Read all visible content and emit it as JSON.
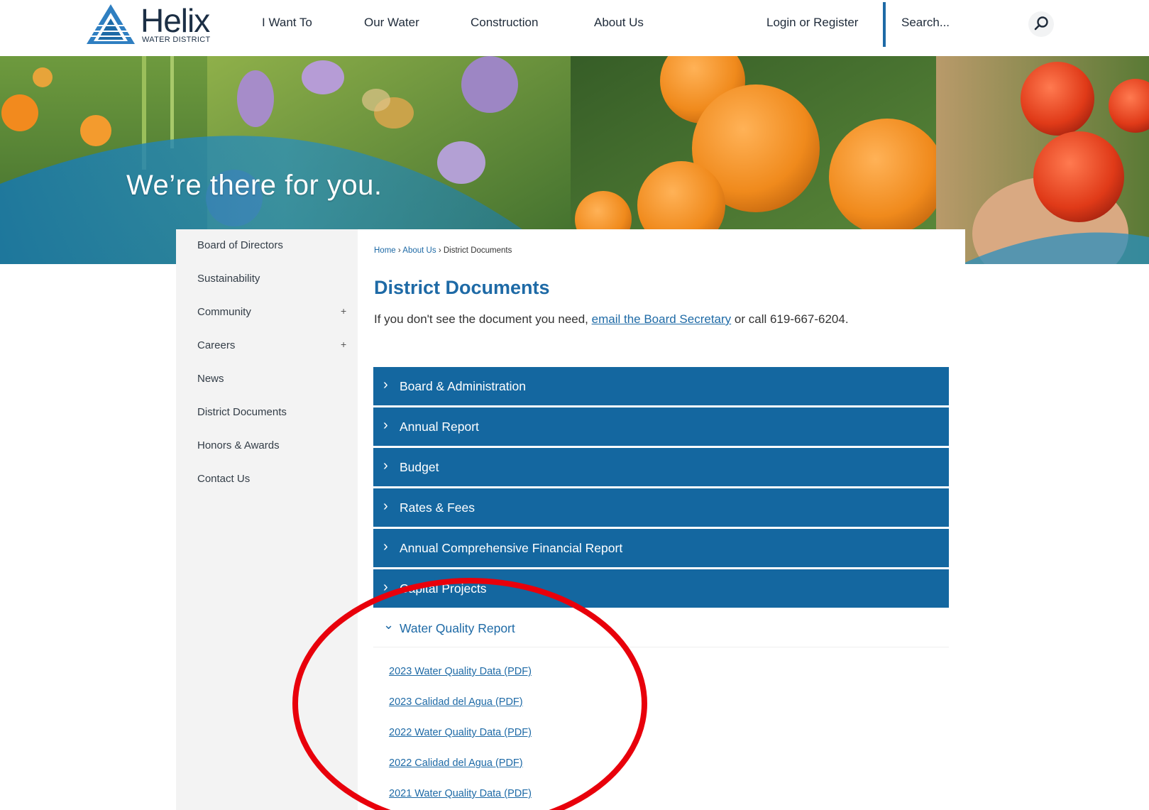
{
  "header": {
    "logo_word": "Helix",
    "logo_sub": "WATER DISTRICT",
    "nav": [
      "I Want To",
      "Our Water",
      "Construction",
      "About Us"
    ],
    "login": "Login or Register",
    "search_placeholder": "Search...",
    "search_icon": "search-icon"
  },
  "hero": {
    "tagline": "We’re there for you."
  },
  "sidebar": {
    "items": [
      {
        "label": "Board of Directors",
        "expandable": false
      },
      {
        "label": "Sustainability",
        "expandable": false
      },
      {
        "label": "Community",
        "expandable": true
      },
      {
        "label": "Careers",
        "expandable": true
      },
      {
        "label": "News",
        "expandable": false
      },
      {
        "label": "District Documents",
        "expandable": false
      },
      {
        "label": "Honors & Awards",
        "expandable": false
      },
      {
        "label": "Contact Us",
        "expandable": false
      }
    ],
    "expand_glyph": "+"
  },
  "breadcrumb": {
    "home": "Home",
    "sep": "›",
    "about": "About Us",
    "current": "District Documents"
  },
  "main": {
    "title": "District Documents",
    "intro_before": "If you don't see the document you need, ",
    "intro_link": "email the Board Secretary",
    "intro_after": " or call 619-667-6204.",
    "accordions": [
      {
        "label": "Board & Administration",
        "expanded": false
      },
      {
        "label": "Annual Report",
        "expanded": false
      },
      {
        "label": "Budget",
        "expanded": false
      },
      {
        "label": "Rates & Fees",
        "expanded": false
      },
      {
        "label": "Annual Comprehensive Financial Report",
        "expanded": false
      },
      {
        "label": "Capital Projects",
        "expanded": false
      },
      {
        "label": "Water Quality Report",
        "expanded": true
      }
    ],
    "collapsed_glyph": "›",
    "expanded_glyph": "⌄",
    "water_quality_links": [
      "2023 Water Quality Data (PDF)",
      "2023 Calidad del Agua (PDF)",
      "2022 Water Quality Data (PDF)",
      "2022 Calidad del Agua (PDF)",
      "2021 Water Quality Data (PDF)"
    ]
  },
  "colors": {
    "brand_blue": "#1467a0",
    "link_blue": "#1e6aa6",
    "annotation_red": "#e8000b"
  }
}
